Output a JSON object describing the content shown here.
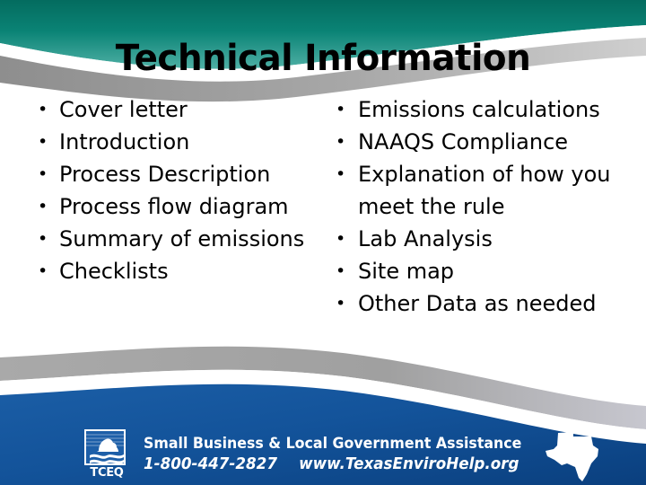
{
  "slide": {
    "title": "Technical Information",
    "background_color": "#ffffff"
  },
  "theme": {
    "header_teal_dark": "#057d6e",
    "header_teal_light": "#43a79c",
    "wave_gray": "#9a9a9a",
    "footer_blue": "#17559d",
    "footer_blue_dark": "#0d4a8f",
    "text_black": "#000000",
    "text_white": "#ffffff"
  },
  "columns": {
    "left": {
      "bullets": [
        "Cover letter",
        "Introduction",
        "Process Description",
        "Process flow diagram",
        "Summary of emissions",
        "Checklists"
      ]
    },
    "right": {
      "bullets": [
        "Emissions calculations",
        "NAAQS Compliance",
        "Explanation of how you meet the rule",
        "Lab Analysis",
        "Site map",
        "Other Data as needed"
      ]
    }
  },
  "footer": {
    "logo_word": "TCEQ",
    "logo_icon": "tceq-mountain-water-logo",
    "program_name": "Small Business & Local Government Assistance",
    "phone": "1-800-447-2827",
    "website": "www.TexasEnviroHelp.org",
    "texas_icon": "texas-state-outline-icon"
  }
}
